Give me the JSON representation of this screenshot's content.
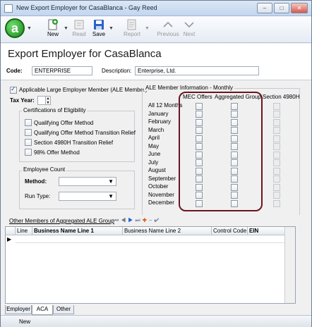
{
  "window": {
    "title": "New Export Employer for CasaBlanca - Gay Reed",
    "controls": [
      "–",
      "□",
      "✕"
    ]
  },
  "toolbar": {
    "new": "New",
    "read": "Read",
    "save": "Save",
    "report": "Report",
    "previous": "Previous",
    "next": "Next",
    "logo": "a"
  },
  "header": {
    "title": "Export Employer for CasaBlanca",
    "code_label": "Code:",
    "code_value": "ENTERPRISE",
    "description_label": "Description:",
    "description_value": "Enterprise, Ltd."
  },
  "left": {
    "ale_member_label": "Applicable Large Employer Member (ALE Member)",
    "tax_year_label": "Tax Year:",
    "certifications_label": "Certifications of Eligibility",
    "certifications": [
      "Qualifying Offer Method",
      "Qualifying Offer Method Transition Relief",
      "Section 4980H Transition Relief",
      "98% Offer Method"
    ],
    "employee_count_label": "Employee Count",
    "method_label": "Method:",
    "run_type_label": "Run Type:"
  },
  "ale_info": {
    "label": "ALE Member Information - Monthly",
    "columns": [
      "MEC Offers",
      "Aggregated Group",
      "Section 4980H"
    ],
    "months": [
      "All 12 Months",
      "January",
      "February",
      "March",
      "April",
      "May",
      "June",
      "July",
      "August",
      "September",
      "October",
      "November",
      "December"
    ]
  },
  "other_members": {
    "label": "Other Members of Aggregated ALE Group",
    "columns": [
      "Line",
      "Business Name Line 1",
      "Business Name Line 2",
      "Control Code",
      "EIN"
    ]
  },
  "tabs": [
    "Employer",
    "ACA",
    "Other"
  ],
  "status": {
    "text": "New"
  },
  "colors": {
    "highlight_border": "#6b1420",
    "logo_green": "#1b8a1b"
  }
}
